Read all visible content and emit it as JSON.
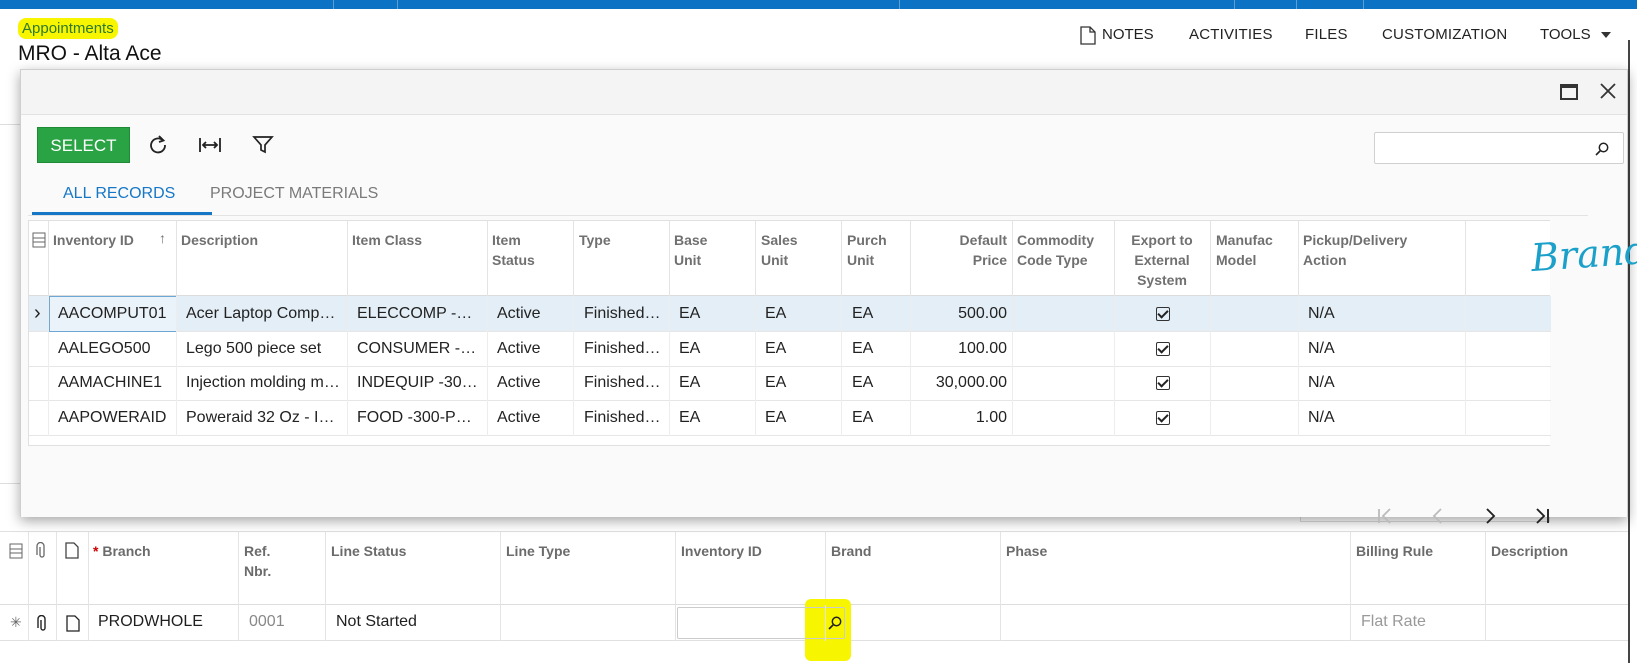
{
  "breadcrumb": "Appointments",
  "page_title": "MRO - Alta Ace",
  "toolbar": {
    "notes": "NOTES",
    "activities": "ACTIVITIES",
    "files": "FILES",
    "customization": "CUSTOMIZATION",
    "tools": "TOOLS"
  },
  "dialog": {
    "select_label": "SELECT",
    "search_placeholder": "",
    "tabs": [
      "ALL RECORDS",
      "PROJECT MATERIALS"
    ],
    "columns": {
      "inventory_id": "Inventory ID",
      "description": "Description",
      "item_class": "Item Class",
      "item_status": [
        "Item",
        "Status"
      ],
      "type": "Type",
      "base_unit": [
        "Base",
        "Unit"
      ],
      "sales_unit": [
        "Sales",
        "Unit"
      ],
      "purch_unit": [
        "Purch",
        "Unit"
      ],
      "default_price": [
        "Default",
        "Price"
      ],
      "commodity": [
        "Commodity",
        "Code Type"
      ],
      "export": [
        "Export to",
        "External",
        "System"
      ],
      "manufac": [
        "Manufac",
        "Model"
      ],
      "pickup": [
        "Pickup/Delivery",
        "Action"
      ]
    },
    "rows": [
      {
        "id": "AACOMPUT01",
        "desc": "Acer Laptop Comp…",
        "cls": "ELECCOMP -…",
        "status": "Active",
        "type": "Finished…",
        "base": "EA",
        "sales": "EA",
        "purch": "EA",
        "price": "500.00",
        "pickup": "N/A"
      },
      {
        "id": "AALEGO500",
        "desc": "Lego 500 piece set",
        "cls": "CONSUMER -…",
        "status": "Active",
        "type": "Finished…",
        "base": "EA",
        "sales": "EA",
        "purch": "EA",
        "price": "100.00",
        "pickup": "N/A"
      },
      {
        "id": "AAMACHINE1",
        "desc": "Injection molding m…",
        "cls": "INDEQUIP -30…",
        "status": "Active",
        "type": "Finished…",
        "base": "EA",
        "sales": "EA",
        "purch": "EA",
        "price": "30,000.00",
        "pickup": "N/A"
      },
      {
        "id": "AAPOWERAID",
        "desc": "Poweraid 32 Oz - I…",
        "cls": "FOOD -300-P…",
        "status": "Active",
        "type": "Finished…",
        "base": "EA",
        "sales": "EA",
        "purch": "EA",
        "price": "1.00",
        "pickup": "N/A"
      }
    ],
    "annotation": "Brand"
  },
  "details_grid": {
    "columns": {
      "branch": "Branch",
      "ref_nbr": [
        "Ref.",
        "Nbr."
      ],
      "line_status": "Line Status",
      "line_type": "Line Type",
      "inventory_id": "Inventory ID",
      "brand": "Brand",
      "phase": "Phase",
      "billing_rule": "Billing Rule",
      "description": "Description"
    },
    "row": {
      "branch": "PRODWHOLE",
      "ref_nbr": "0001",
      "line_status": "Not Started",
      "billing_rule": "Flat Rate"
    }
  },
  "colors": {
    "accent": "#1677c7",
    "select_button": "#2aa345",
    "topbar": "#0c72c3",
    "highlight": "#f8f500"
  }
}
